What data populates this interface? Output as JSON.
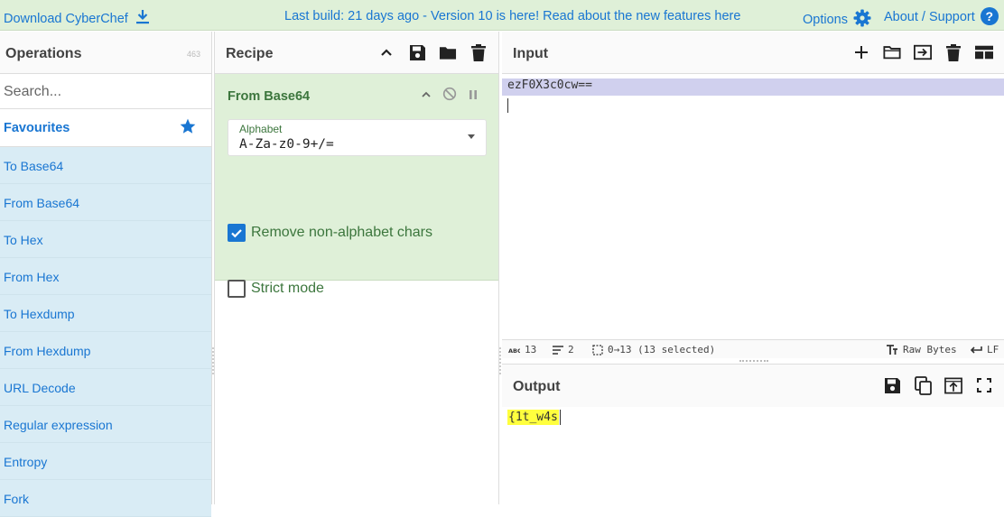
{
  "banner": {
    "download_label": "Download CyberChef",
    "notice": "Last build: 21 days ago - Version 10 is here! Read about the new features here",
    "options_label": "Options",
    "about_label": "About / Support",
    "help_glyph": "?"
  },
  "operations": {
    "title": "Operations",
    "count": "463",
    "search_placeholder": "Search...",
    "favourites_label": "Favourites",
    "items": [
      "To Base64",
      "From Base64",
      "To Hex",
      "From Hex",
      "To Hexdump",
      "From Hexdump",
      "URL Decode",
      "Regular expression",
      "Entropy",
      "Fork"
    ]
  },
  "recipe": {
    "title": "Recipe",
    "operation": {
      "name": "From Base64",
      "alphabet_label": "Alphabet",
      "alphabet_value": "A-Za-z0-9+/=",
      "remove_nonalpha_label": "Remove non-alphabet chars",
      "remove_nonalpha_checked": true,
      "strict_mode_label": "Strict mode",
      "strict_mode_checked": false
    }
  },
  "input": {
    "title": "Input",
    "text": "ezF0X3c0cw==",
    "status": {
      "length": "13",
      "lines": "2",
      "selection": "0→13 (13 selected)",
      "encoding": "Raw Bytes",
      "eol": "LF"
    }
  },
  "output": {
    "title": "Output",
    "text": "{1t_w4s"
  },
  "colors": {
    "accent": "#1976d2",
    "banner_bg": "#dff0d8",
    "recipe_op_bg": "#dff0d8",
    "op_list_bg": "#d9ecf5",
    "selection_bg": "#d0d0ee",
    "highlight": "#ffff3e"
  }
}
